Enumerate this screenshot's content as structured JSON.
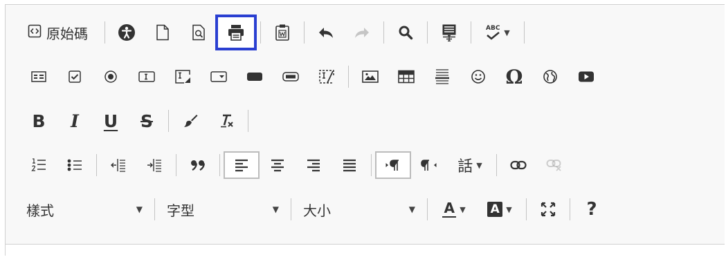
{
  "toolbar": {
    "source_label": "原始碼",
    "bidi_label": "話",
    "styles_label": "樣式",
    "font_label": "字型",
    "size_label": "大小",
    "text_color_label": "A",
    "bg_color_label": "A",
    "help_label": "?",
    "bold_label": "B",
    "italic_label": "I",
    "underline_label": "U",
    "strike_label": "S",
    "spell_label": "ABC",
    "colors": {
      "focus_border": "#2a3fd1",
      "icon": "#333333",
      "disabled": "#a0a0a0"
    }
  }
}
